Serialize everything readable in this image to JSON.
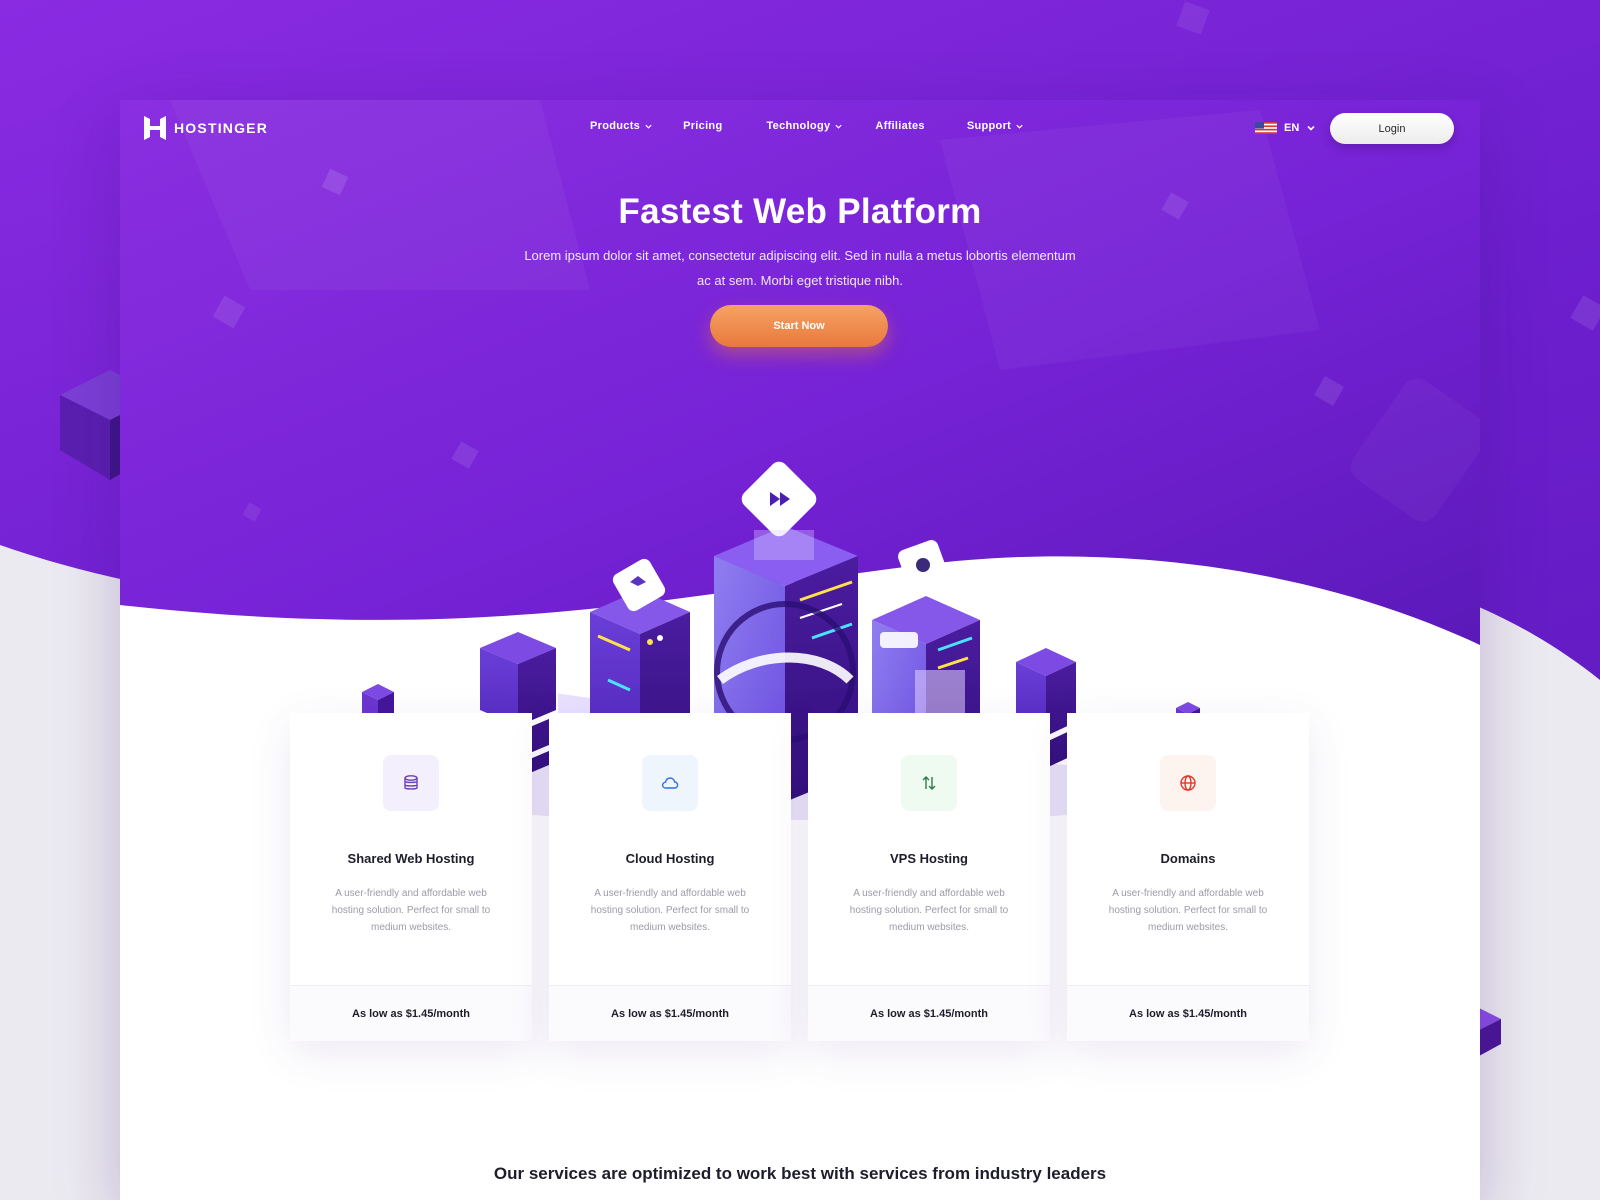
{
  "brand": {
    "name": "HOSTINGER",
    "primary_color": "#7a24d8",
    "accent_color": "#ec8344"
  },
  "nav": {
    "items": [
      {
        "label": "Products",
        "has_dropdown": true
      },
      {
        "label": "Pricing",
        "has_dropdown": false
      },
      {
        "label": "Technology",
        "has_dropdown": true
      },
      {
        "label": "Affiliates",
        "has_dropdown": false
      },
      {
        "label": "Support",
        "has_dropdown": true
      }
    ]
  },
  "header": {
    "language": "EN",
    "flag_icon": "us-flag-icon",
    "login_label": "Login"
  },
  "hero": {
    "title": "Fastest Web Platform",
    "subtitle": "Lorem ipsum dolor sit amet, consectetur adipiscing elit. Sed in nulla a metus lobortis elementum ac at sem. Morbi eget tristique nibh.",
    "cta_label": "Start Now"
  },
  "cards": [
    {
      "title": "Shared Web Hosting",
      "description": "A user-friendly and affordable web hosting solution. Perfect for small to medium websites.",
      "price": "As low as $1.45/month",
      "icon": "database-icon",
      "icon_color": "#6b3fb8",
      "icon_bg": "#f4effc"
    },
    {
      "title": "Cloud Hosting",
      "description": "A user-friendly and affordable web hosting solution. Perfect for small to medium websites.",
      "price": "As low as $1.45/month",
      "icon": "cloud-icon",
      "icon_color": "#2f6fe0",
      "icon_bg": "#eff5fd"
    },
    {
      "title": "VPS Hosting",
      "description": "A user-friendly and affordable web hosting solution. Perfect for small to medium websites.",
      "price": "As low as $1.45/month",
      "icon": "up-down-arrows-icon",
      "icon_color": "#2e7a4a",
      "icon_bg": "#effaf1"
    },
    {
      "title": "Domains",
      "description": "A user-friendly and affordable web hosting solution. Perfect for small to medium websites.",
      "price": "As low as $1.45/month",
      "icon": "globe-icon",
      "icon_color": "#e0392b",
      "icon_bg": "#fdf3ef"
    }
  ],
  "footer_heading": "Our services are optimized to work best with services from industry leaders"
}
